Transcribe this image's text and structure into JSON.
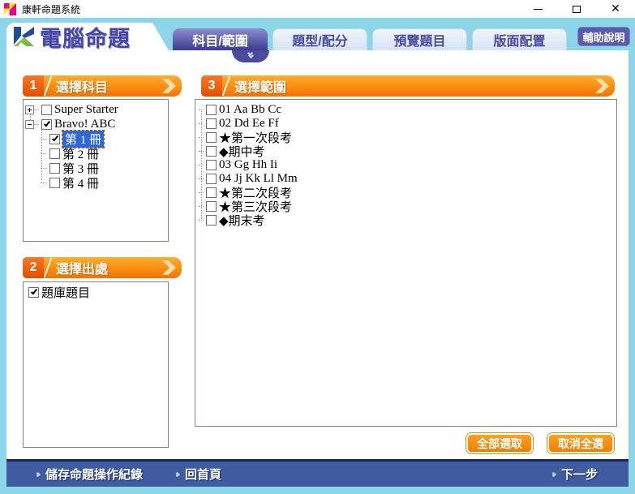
{
  "window": {
    "title": "康軒命題系統"
  },
  "header": {
    "logo_title": "電腦命題",
    "tabs": [
      {
        "label": "科目/範圍",
        "active": true
      },
      {
        "label": "題型/配分",
        "active": false
      },
      {
        "label": "預覽題目",
        "active": false
      },
      {
        "label": "版面配置",
        "active": false
      }
    ],
    "help_button": "輔助說明"
  },
  "step1": {
    "number": "1",
    "title": "選擇科目",
    "tree": [
      {
        "label": "Super Starter",
        "checked": false,
        "collapsed": true
      },
      {
        "label": "Bravo! ABC",
        "checked": true,
        "collapsed": false
      },
      {
        "label": "第 1 冊",
        "checked": true,
        "selected": true
      },
      {
        "label": "第 2 冊",
        "checked": false
      },
      {
        "label": "第 3 冊",
        "checked": false
      },
      {
        "label": "第 4 冊",
        "checked": false
      }
    ]
  },
  "step2": {
    "number": "2",
    "title": "選擇出處",
    "items": [
      {
        "label": "題庫題目",
        "checked": true
      }
    ]
  },
  "step3": {
    "number": "3",
    "title": "選擇範圍",
    "items": [
      {
        "label": "01 Aa Bb Cc",
        "checked": false
      },
      {
        "label": "02 Dd Ee Ff",
        "checked": false
      },
      {
        "label": "★第一次段考",
        "checked": false
      },
      {
        "label": "◆期中考",
        "checked": false
      },
      {
        "label": "03 Gg Hh Ii",
        "checked": false
      },
      {
        "label": "04 Jj Kk Ll Mm",
        "checked": false
      },
      {
        "label": "★第二次段考",
        "checked": false
      },
      {
        "label": "★第三次段考",
        "checked": false
      },
      {
        "label": "◆期末考",
        "checked": false
      }
    ],
    "select_all": "全部選取",
    "deselect_all": "取消全選"
  },
  "footer": {
    "save": "儲存命題操作紀錄",
    "home": "回首頁",
    "next": "下一步"
  },
  "colors": {
    "frame_cyan": "#8BD6E9",
    "accent_orange": "#F47300",
    "active_tab_purple": "#3C3C90",
    "selection_blue": "#2E6AD3",
    "footer_blue": "#3E5C9F"
  }
}
